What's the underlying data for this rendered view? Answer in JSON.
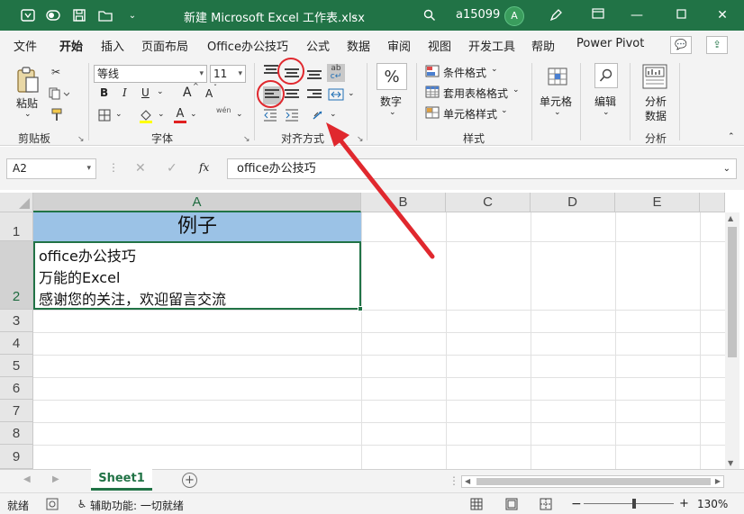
{
  "titlebar": {
    "autosave_icon": "autosave-icon",
    "doc_title": "新建 Microsoft Excel 工作表.xlsx",
    "user": "a15099",
    "avatar_letter": "A",
    "controls": [
      "restore-ribbon-icon",
      "minimize-icon",
      "maximize-icon",
      "close-icon"
    ]
  },
  "tabs": [
    "文件",
    "开始",
    "插入",
    "页面布局",
    "Office办公技巧",
    "公式",
    "数据",
    "审阅",
    "视图",
    "开发工具",
    "帮助",
    "Power Pivot"
  ],
  "active_tab": "开始",
  "ribbon": {
    "clipboard": {
      "paste": "粘贴",
      "group": "剪贴板"
    },
    "font": {
      "name": "等线",
      "size": "11",
      "bold": "B",
      "italic": "I",
      "underline": "U",
      "grow": "A",
      "shrink": "A",
      "color_letter": "A",
      "phonetic": "wén",
      "group": "字体"
    },
    "alignment": {
      "group": "对齐方式"
    },
    "number": {
      "label": "数字",
      "symbol": "%"
    },
    "styles": {
      "conditional": "条件格式",
      "table": "套用表格格式",
      "cell_styles": "单元格样式",
      "group": "样式"
    },
    "cells": {
      "label": "单元格"
    },
    "editing": {
      "label": "编辑"
    },
    "analysis": {
      "label1": "分析",
      "label2": "数据",
      "group": "分析"
    }
  },
  "formula_bar": {
    "name_box": "A2",
    "fx": "fx",
    "content": "office办公技巧"
  },
  "columns": [
    "A",
    "B",
    "C",
    "D",
    "E"
  ],
  "rows": [
    "1",
    "2",
    "3",
    "4",
    "5",
    "6",
    "7",
    "8",
    "9"
  ],
  "cells": {
    "A1": "例子",
    "A2_lines": [
      "office办公技巧",
      "万能的Excel",
      "感谢您的关注，欢迎留言交流"
    ]
  },
  "sheet_tabs": [
    "Sheet1"
  ],
  "status": {
    "ready": "就绪",
    "accessibility": "辅助功能: 一切就绪",
    "zoom": "130%"
  },
  "colors": {
    "excel_green": "#217346",
    "header_fill": "#9bc2e6",
    "annotation_red": "#e0282e"
  }
}
